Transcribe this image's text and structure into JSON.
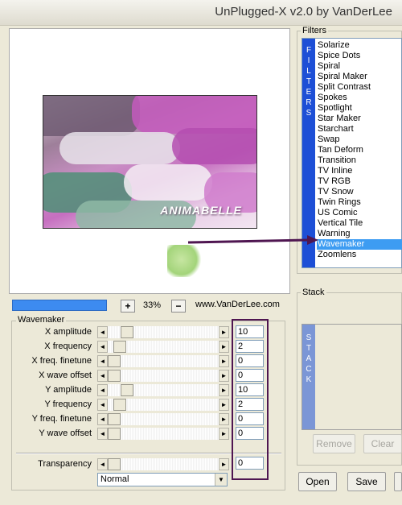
{
  "window": {
    "title": "UnPlugged-X v2.0 by VanDerLee"
  },
  "preview": {
    "watermark": "ANIMABELLE"
  },
  "filters": {
    "group_label": "Filters",
    "strip_letters": [
      "F",
      "I",
      "L",
      "T",
      "E",
      "R",
      "S"
    ],
    "items": [
      "Solarize",
      "Spice Dots",
      "Spiral",
      "Spiral Maker",
      "Split Contrast",
      "Spokes",
      "Spotlight",
      "Star Maker",
      "Starchart",
      "Swap",
      "Tan Deform",
      "Transition",
      "TV Inline",
      "TV RGB",
      "TV Snow",
      "Twin Rings",
      "US Comic",
      "Vertical Tile",
      "Warning",
      "Wavemaker",
      "Zoomlens"
    ],
    "selected": "Wavemaker"
  },
  "zoom": {
    "plus": "+",
    "minus": "−",
    "value": "33%",
    "website": "www.VanDerLee.com"
  },
  "wavemaker": {
    "group_label": "Wavemaker",
    "params": [
      {
        "label": "X amplitude",
        "value": "10"
      },
      {
        "label": "X frequency",
        "value": "2"
      },
      {
        "label": "X freq. finetune",
        "value": "0"
      },
      {
        "label": "X wave offset",
        "value": "0"
      },
      {
        "label": "Y amplitude",
        "value": "10"
      },
      {
        "label": "Y frequency",
        "value": "2"
      },
      {
        "label": "Y freq. finetune",
        "value": "0"
      },
      {
        "label": "Y wave offset",
        "value": "0"
      }
    ],
    "transparency": {
      "label": "Transparency",
      "value": "0"
    },
    "blend_mode": "Normal"
  },
  "stack": {
    "group_label": "Stack",
    "strip_letters": [
      "S",
      "T",
      "A",
      "C",
      "K"
    ],
    "remove_label": "Remove",
    "clear_label": "Clear"
  },
  "footer": {
    "open_label": "Open",
    "save_label": "Save"
  },
  "colors": {
    "selection": "#3d9cf2",
    "filters_strip": "#1d4fd6",
    "annotation": "#4f1651",
    "dialog_bg": "#ece9d8"
  },
  "icons": {
    "arrow_left": "◄",
    "arrow_right": "►",
    "dropdown": "▼"
  }
}
